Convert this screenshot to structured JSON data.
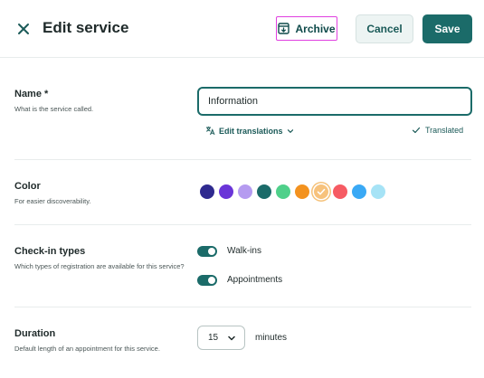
{
  "header": {
    "title": "Edit service",
    "archive_label": "Archive",
    "cancel_label": "Cancel",
    "save_label": "Save"
  },
  "name_section": {
    "label": "Name *",
    "description": "What is the service called.",
    "value": "Information",
    "edit_translations_label": "Edit translations",
    "translated_label": "Translated"
  },
  "color_section": {
    "label": "Color",
    "description": "For easier discoverability.",
    "swatches": [
      "#2f2a8f",
      "#6a35d8",
      "#b59bf0",
      "#1b6b69",
      "#4fd08a",
      "#f3921f",
      "#f7c27c",
      "#f65b63",
      "#3aa9f5",
      "#a6e3f6"
    ],
    "selected_index": 6
  },
  "checkin_section": {
    "label": "Check-in types",
    "description": "Which types of registration are available for this service?",
    "options": [
      {
        "label": "Walk-ins",
        "enabled": true
      },
      {
        "label": "Appointments",
        "enabled": true
      }
    ]
  },
  "duration_section": {
    "label": "Duration",
    "description": "Default length of an appointment for this service.",
    "value": "15",
    "unit": "minutes"
  },
  "colors": {
    "accent": "#1b6b69",
    "highlight_border": "#e040e0"
  },
  "icons": {
    "close": "close-icon",
    "archive": "archive-icon",
    "translate": "translate-icon",
    "chevron": "chevron-down-icon",
    "check": "check-icon"
  }
}
